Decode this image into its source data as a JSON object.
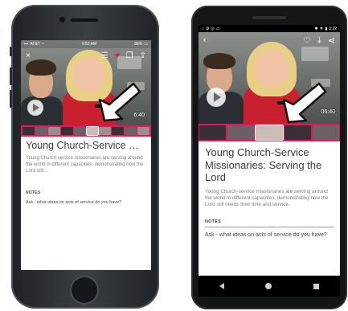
{
  "ios": {
    "status": {
      "carrier": "AT&T",
      "time": "9:52 AM",
      "battery": "86%"
    },
    "toolbar": {
      "close_icon": "×"
    },
    "duration": "6:40",
    "title": "Young Church-Service Missi...",
    "description": "Young Church-service missionaries are serving around the world in different capacities, demonstrating how the Lord still...",
    "notes_heading": "NOTES",
    "note": "Ask - what ideas on acts of service do you have?"
  },
  "android": {
    "status": {
      "time": "3:22"
    },
    "duration": "06:40",
    "title": "Young Church-Service Missionaries: Serving the Lord",
    "description": "Young Church-service missionaries are serving around the world in different capacities, demonstrating how the Lord still needs their time and service.",
    "notes_heading": "NOTES",
    "note": "Ask - what ideas on acts of service do you have?"
  },
  "colors": {
    "accent": "#e5155e"
  }
}
